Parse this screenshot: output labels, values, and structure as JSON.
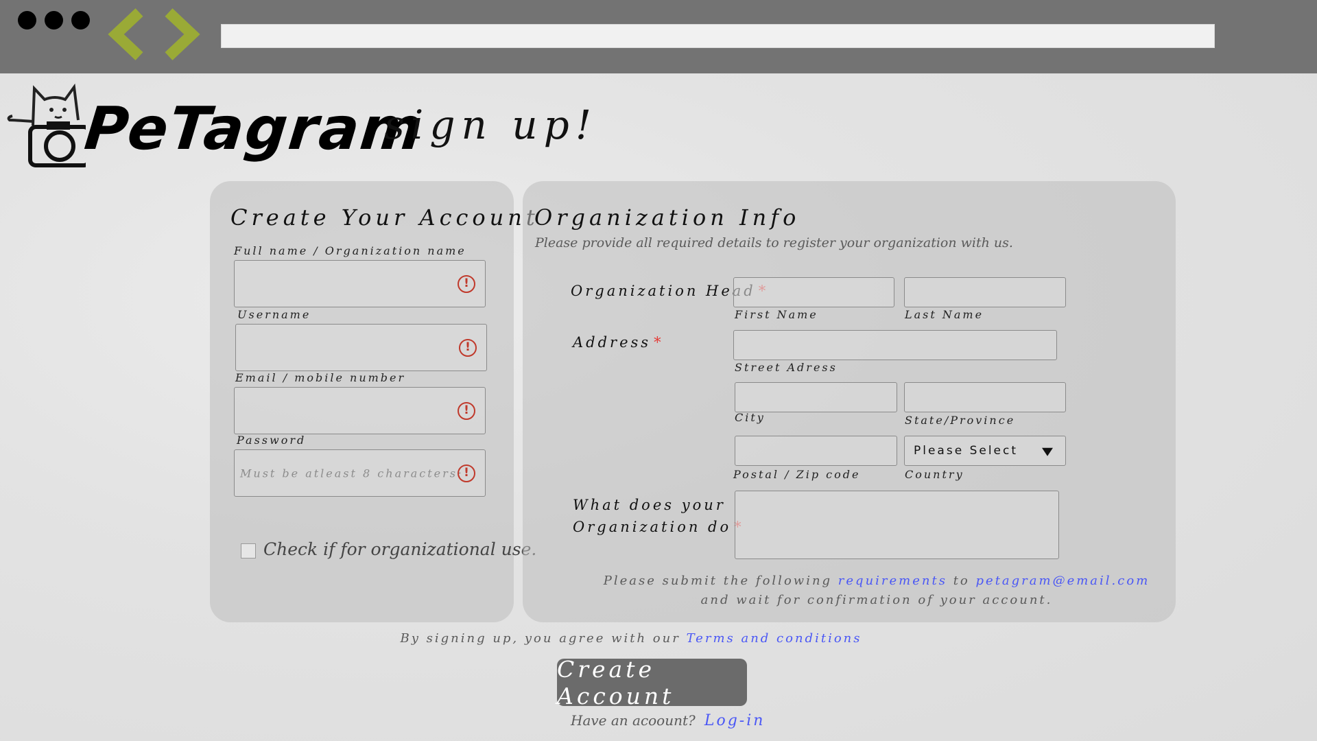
{
  "browser": {
    "url": ""
  },
  "logo": {
    "brand": "PeTagram",
    "tagline": "sign up!"
  },
  "account": {
    "heading": "Create Your Account",
    "fullname_label": "Full name / Organization name",
    "username_label": "Username",
    "email_label": "Email / mobile number",
    "password_label": "Password",
    "password_placeholder": "Must be atleast 8  characters:",
    "alert_symbol": "!",
    "org_checkbox_label": "Check if for organizational use."
  },
  "org": {
    "heading": "Organization Info",
    "subtitle": "Please provide all required details to register your organization with us.",
    "head_label": "Organization Head",
    "required_mark": "*",
    "first_name": "First Name",
    "last_name": "Last Name",
    "address_label": "Address",
    "street": "Street Adress",
    "city": "City",
    "state": "State/Province",
    "zip": "Postal / Zip code",
    "country": "Country",
    "country_select": "Please Select",
    "what_label_1": "What does your",
    "what_label_2": "Organization do",
    "submit_1": "Please submit the following",
    "submit_link": "requirements",
    "submit_to": "to",
    "submit_email": "petagram@email.com",
    "submit_2": "and wait for confirmation of your account."
  },
  "footer": {
    "terms_text": "By signing up, you agree with our",
    "terms_link": "Terms and conditions",
    "create_button": "Create Account",
    "have_account": "Have an acoount?",
    "login_link": "Log-in"
  },
  "colors": {
    "link": "#4a57f5",
    "required": "#e53935",
    "nav_arrow": "#9aaa36",
    "chrome": "#737373",
    "button": "#6b6b6b"
  }
}
